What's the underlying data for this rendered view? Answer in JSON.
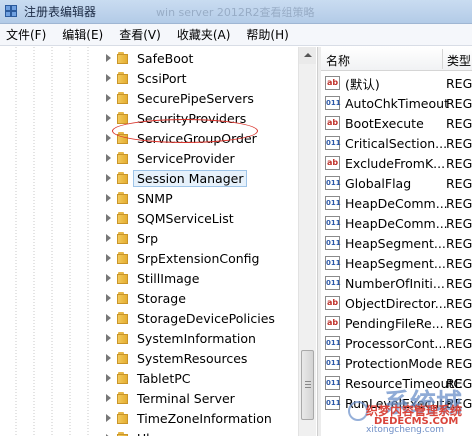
{
  "window": {
    "title": "注册表编辑器",
    "title_faded": "win server 2012R2查看组策略"
  },
  "menu": [
    "文件(F)",
    "编辑(E)",
    "查看(V)",
    "收藏夹(A)",
    "帮助(H)"
  ],
  "tree": {
    "items": [
      {
        "label": "SafeBoot"
      },
      {
        "label": "ScsiPort"
      },
      {
        "label": "SecurePipeServers"
      },
      {
        "label": "SecurityProviders"
      },
      {
        "label": "ServiceGroupOrder"
      },
      {
        "label": "ServiceProvider"
      },
      {
        "label": "Session Manager",
        "selected": true
      },
      {
        "label": "SNMP"
      },
      {
        "label": "SQMServiceList"
      },
      {
        "label": "Srp"
      },
      {
        "label": "SrpExtensionConfig"
      },
      {
        "label": "StillImage"
      },
      {
        "label": "Storage"
      },
      {
        "label": "StorageDevicePolicies"
      },
      {
        "label": "SystemInformation"
      },
      {
        "label": "SystemResources"
      },
      {
        "label": "TabletPC"
      },
      {
        "label": "Terminal Server"
      },
      {
        "label": "TimeZoneInformation"
      },
      {
        "label": "Ubpm"
      }
    ]
  },
  "list": {
    "col_name": "名称",
    "col_type": "类型",
    "rows": [
      {
        "icon": "ab",
        "name": "(默认)",
        "type": "REG_"
      },
      {
        "icon": "bin",
        "name": "AutoChkTimeout",
        "type": "REG_"
      },
      {
        "icon": "ab",
        "name": "BootExecute",
        "type": "REG_"
      },
      {
        "icon": "bin",
        "name": "CriticalSection...",
        "type": "REG_"
      },
      {
        "icon": "ab",
        "name": "ExcludeFromK...",
        "type": "REG_"
      },
      {
        "icon": "bin",
        "name": "GlobalFlag",
        "type": "REG_"
      },
      {
        "icon": "bin",
        "name": "HeapDeComm...",
        "type": "REG_"
      },
      {
        "icon": "bin",
        "name": "HeapDeComm...",
        "type": "REG_"
      },
      {
        "icon": "bin",
        "name": "HeapSegment...",
        "type": "REG_"
      },
      {
        "icon": "bin",
        "name": "HeapSegment...",
        "type": "REG_"
      },
      {
        "icon": "bin",
        "name": "NumberOfIniti...",
        "type": "REG_"
      },
      {
        "icon": "ab",
        "name": "ObjectDirector...",
        "type": "REG_"
      },
      {
        "icon": "ab",
        "name": "PendingFileRe...",
        "type": "REG_"
      },
      {
        "icon": "bin",
        "name": "ProcessorCont...",
        "type": "REG_"
      },
      {
        "icon": "bin",
        "name": "ProtectionMode",
        "type": "REG_"
      },
      {
        "icon": "bin",
        "name": "ResourceTimeoutCount",
        "type": "REG_"
      },
      {
        "icon": "bin",
        "name": "RunLevelExecute",
        "type": "REG_"
      }
    ]
  },
  "watermark": {
    "big": "系统城",
    "mid": "织梦内容管理系统",
    "domain": "DEDECMS.COM",
    "small": "xitongcheng.com"
  }
}
